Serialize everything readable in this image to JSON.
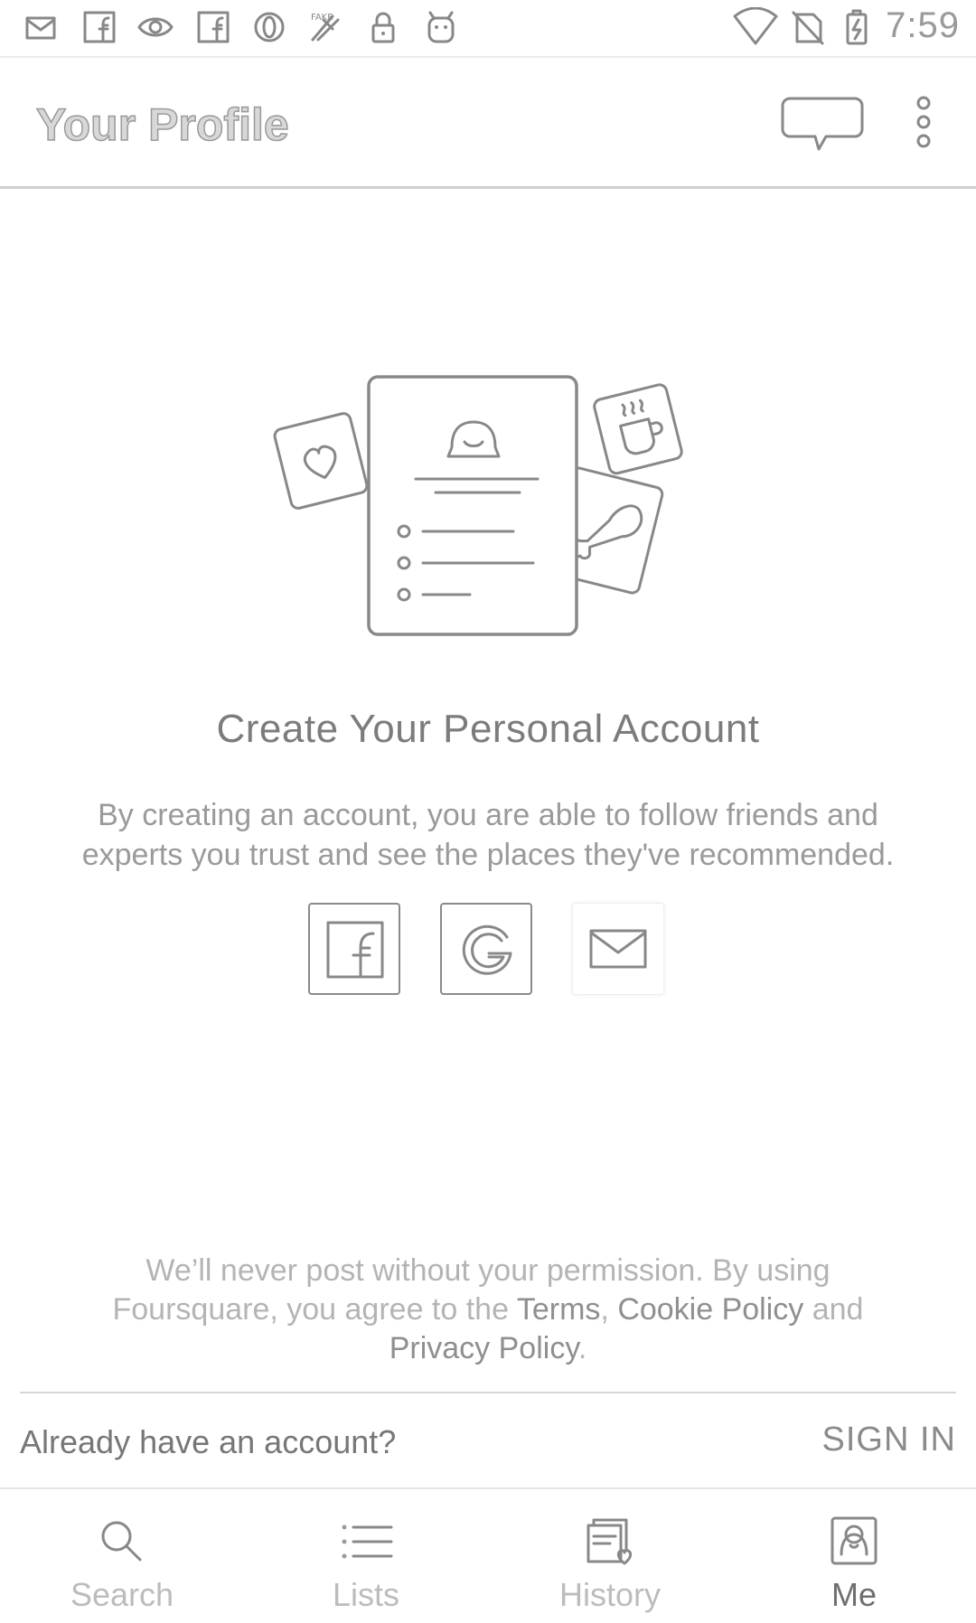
{
  "status_bar": {
    "time": "7:59",
    "left_icons": [
      "mail-icon",
      "facebook-icon",
      "eye-icon",
      "facebook-icon",
      "opera-icon",
      "fake-gps-icon",
      "lock-icon",
      "android-icon"
    ],
    "right_icons": [
      "wifi-icon",
      "no-sim-icon",
      "battery-charging-icon"
    ]
  },
  "app_bar": {
    "title": "Your Profile",
    "icons": [
      "chat-bubble-icon",
      "more-vert-icon"
    ]
  },
  "main": {
    "headline": "Create Your Personal Account",
    "description": "By creating an account, you are able to follow friends and experts you trust and see the places they've recommended.",
    "social_buttons": [
      "facebook-icon",
      "google-icon",
      "email-icon"
    ]
  },
  "footer": {
    "disclaimer_prefix": "We’ll never post without your permission. By using Foursquare, you agree to the ",
    "terms_link": "Terms",
    "comma": ", ",
    "cookie_link": "Cookie Policy",
    "and_text": " and ",
    "privacy_link": "Privacy Policy",
    "period": ".",
    "already_text": "Already have an account?",
    "sign_in": "SIGN IN"
  },
  "bottom_nav": {
    "items": [
      {
        "label": "Search",
        "icon": "search-icon",
        "active": false
      },
      {
        "label": "Lists",
        "icon": "list-icon",
        "active": false
      },
      {
        "label": "History",
        "icon": "history-icon",
        "active": false
      },
      {
        "label": "Me",
        "icon": "profile-icon",
        "active": true
      }
    ]
  },
  "colors": {
    "background": "#ffffff",
    "text_primary": "#7a7a7a",
    "text_muted": "#b4b4b4",
    "divider": "#d6d6d6"
  }
}
